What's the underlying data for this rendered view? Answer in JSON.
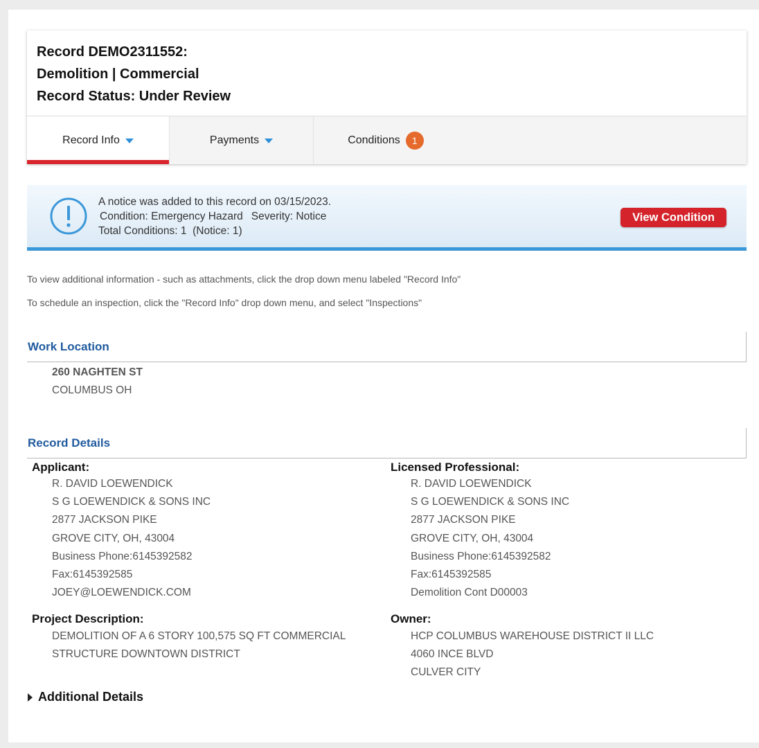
{
  "record": {
    "title": "Record DEMO2311552:",
    "type": "Demolition | Commercial",
    "status": "Record Status: Under Review"
  },
  "tabs": [
    {
      "label": "Record Info"
    },
    {
      "label": "Payments"
    },
    {
      "label": "Conditions",
      "badge": "1"
    }
  ],
  "notice": {
    "line1": "A notice was added to this record on 03/15/2023.",
    "condition": "Condition: Emergency Hazard",
    "severity": "Severity: Notice",
    "total": "Total Conditions: 1  (Notice: 1)",
    "button": "View Condition"
  },
  "help": [
    "To view additional information - such as attachments, click the drop down menu labeled \"Record Info\"",
    "To schedule an inspection, click the \"Record Info\" drop down menu, and select \"Inspections\""
  ],
  "work_location": {
    "title": "Work Location",
    "street": "260 NAGHTEN ST",
    "city": "COLUMBUS OH"
  },
  "record_details": {
    "title": "Record Details",
    "applicant": {
      "label": "Applicant:",
      "lines": [
        "R. DAVID LOEWENDICK",
        "S G LOEWENDICK & SONS INC",
        "2877 JACKSON PIKE",
        "GROVE CITY, OH, 43004",
        "Business Phone:6145392582",
        "Fax:6145392585",
        "JOEY@LOEWENDICK.COM"
      ]
    },
    "licensed_professional": {
      "label": "Licensed Professional:",
      "lines": [
        "R. DAVID LOEWENDICK",
        "S G LOEWENDICK & SONS INC",
        "2877 JACKSON PIKE",
        "GROVE CITY, OH, 43004",
        "Business Phone:6145392582",
        "Fax:6145392585",
        "Demolition Cont D00003"
      ]
    },
    "project_description": {
      "label": "Project Description:",
      "lines": [
        "DEMOLITION OF A 6 STORY 100,575 SQ FT COMMERCIAL",
        "STRUCTURE DOWNTOWN DISTRICT"
      ]
    },
    "owner": {
      "label": "Owner:",
      "lines": [
        "HCP COLUMBUS WAREHOUSE DISTRICT II LLC",
        "4060 INCE BLVD",
        "CULVER CITY"
      ]
    }
  },
  "additional_details": "Additional Details",
  "colors": {
    "accent_red": "#d4232a",
    "tab_active": "#d9262c",
    "caret_blue": "#2e8fd8",
    "badge_orange": "#e56a2b",
    "section_blue": "#1f5a9e",
    "notice_border": "#3a97d9"
  },
  "icons": {
    "notice": "exclamation-circle-icon",
    "tab_caret": "caret-down-icon",
    "expand": "triangle-right-icon"
  }
}
